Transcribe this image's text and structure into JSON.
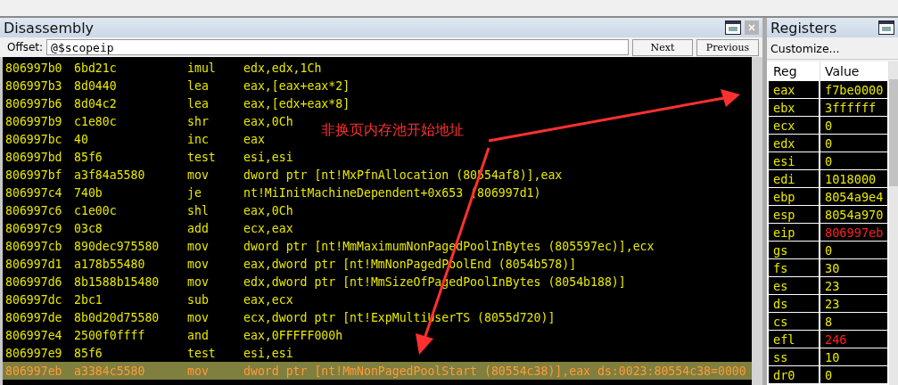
{
  "disassembly": {
    "title": "Disassembly",
    "offset_label": "Offset:",
    "offset_value": "@$scopeip",
    "buttons": [
      "Next",
      "Previous"
    ],
    "rows": [
      {
        "address": "806997b0",
        "bytes": "6bd21c",
        "mnemonic": "imul",
        "operands": "edx,edx,1Ch",
        "selected": false
      },
      {
        "address": "806997b3",
        "bytes": "8d0440",
        "mnemonic": "lea",
        "operands": "eax,[eax+eax*2]",
        "selected": false
      },
      {
        "address": "806997b6",
        "bytes": "8d04c2",
        "mnemonic": "lea",
        "operands": "eax,[edx+eax*8]",
        "selected": false
      },
      {
        "address": "806997b9",
        "bytes": "c1e80c",
        "mnemonic": "shr",
        "operands": "eax,0Ch",
        "selected": false
      },
      {
        "address": "806997bc",
        "bytes": "40",
        "mnemonic": "inc",
        "operands": "eax",
        "selected": false
      },
      {
        "address": "806997bd",
        "bytes": "85f6",
        "mnemonic": "test",
        "operands": "esi,esi",
        "selected": false
      },
      {
        "address": "806997bf",
        "bytes": "a3f84a5580",
        "mnemonic": "mov",
        "operands": "dword ptr [nt!MxPfnAllocation (80554af8)],eax",
        "selected": false
      },
      {
        "address": "806997c4",
        "bytes": "740b",
        "mnemonic": "je",
        "operands": "nt!MiInitMachineDependent+0x653 (806997d1)",
        "selected": false
      },
      {
        "address": "806997c6",
        "bytes": "c1e00c",
        "mnemonic": "shl",
        "operands": "eax,0Ch",
        "selected": false
      },
      {
        "address": "806997c9",
        "bytes": "03c8",
        "mnemonic": "add",
        "operands": "ecx,eax",
        "selected": false
      },
      {
        "address": "806997cb",
        "bytes": "890dec975580",
        "mnemonic": "mov",
        "operands": "dword ptr [nt!MmMaximumNonPagedPoolInBytes (805597ec)],ecx",
        "selected": false
      },
      {
        "address": "806997d1",
        "bytes": "a178b55480",
        "mnemonic": "mov",
        "operands": "eax,dword ptr [nt!MmNonPagedPoolEnd (8054b578)]",
        "selected": false
      },
      {
        "address": "806997d6",
        "bytes": "8b1588b15480",
        "mnemonic": "mov",
        "operands": "edx,dword ptr [nt!MmSizeOfPagedPoolInBytes (8054b188)]",
        "selected": false
      },
      {
        "address": "806997dc",
        "bytes": "2bc1",
        "mnemonic": "sub",
        "operands": "eax,ecx",
        "selected": false
      },
      {
        "address": "806997de",
        "bytes": "8b0d20d75580",
        "mnemonic": "mov",
        "operands": "ecx,dword ptr [nt!ExpMultiUserTS (8055d720)]",
        "selected": false
      },
      {
        "address": "806997e4",
        "bytes": "2500f0ffff",
        "mnemonic": "and",
        "operands": "eax,0FFFFF000h",
        "selected": false
      },
      {
        "address": "806997e9",
        "bytes": "85f6",
        "mnemonic": "test",
        "operands": "esi,esi",
        "selected": false
      },
      {
        "address": "806997eb",
        "bytes": "a3384c5580",
        "mnemonic": "mov",
        "operands": "dword ptr [nt!MmNonPagedPoolStart (80554c38)],eax ds:0023:80554c38=0000",
        "selected": true
      }
    ]
  },
  "annotation": {
    "text": "非换页内存池开始地址"
  },
  "registers": {
    "title": "Registers",
    "customize": "Customize...",
    "columns": [
      "Reg",
      "Value"
    ],
    "rows": [
      {
        "reg": "eax",
        "value": "f7be0000",
        "changed": false
      },
      {
        "reg": "ebx",
        "value": "3ffffff",
        "changed": false
      },
      {
        "reg": "ecx",
        "value": "0",
        "changed": false
      },
      {
        "reg": "edx",
        "value": "0",
        "changed": false
      },
      {
        "reg": "esi",
        "value": "0",
        "changed": false
      },
      {
        "reg": "edi",
        "value": "1018000",
        "changed": false
      },
      {
        "reg": "ebp",
        "value": "8054a9e4",
        "changed": false
      },
      {
        "reg": "esp",
        "value": "8054a970",
        "changed": false
      },
      {
        "reg": "eip",
        "value": "806997eb",
        "changed": true
      },
      {
        "reg": "gs",
        "value": "0",
        "changed": false
      },
      {
        "reg": "fs",
        "value": "30",
        "changed": false
      },
      {
        "reg": "es",
        "value": "23",
        "changed": false
      },
      {
        "reg": "ds",
        "value": "23",
        "changed": false
      },
      {
        "reg": "cs",
        "value": "8",
        "changed": false
      },
      {
        "reg": "efl",
        "value": "246",
        "changed": true
      },
      {
        "reg": "ss",
        "value": "10",
        "changed": false
      },
      {
        "reg": "dr0",
        "value": "0",
        "changed": false
      }
    ]
  }
}
